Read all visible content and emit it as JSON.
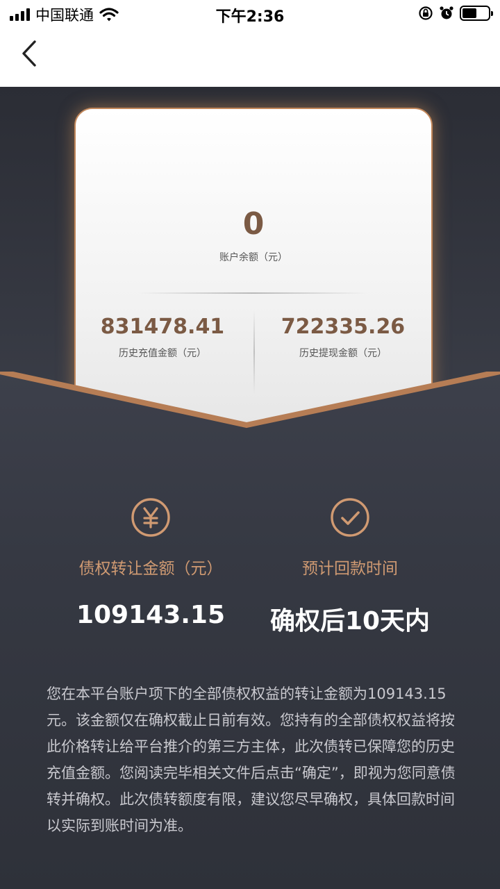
{
  "status_bar": {
    "carrier": "中国联通",
    "time": "下午2:36"
  },
  "card": {
    "balance_value": "0",
    "balance_label": "账户余额（元）",
    "recharge_value": "831478.41",
    "recharge_label": "历史充值金额（元）",
    "withdraw_value": "722335.26",
    "withdraw_label": "历史提现金额（元）"
  },
  "features": {
    "transfer_label": "债权转让金额（元）",
    "transfer_value": "109143.15",
    "repay_label": "预计回款时间",
    "repay_value": "确权后10天内"
  },
  "description": "您在本平台账户项下的全部债权权益的转让金额为109143.15元。该金额仅在确权截止日前有效。您持有的全部债权权益将按此价格转让给平台推介的第三方主体，此次债转已保障您的历史充值金额。您阅读完毕相关文件后点击“确定”，即视为您同意债转并确权。此次债转额度有限，建议您尽早确权，具体回款时间以实际到账时间为准。",
  "colors": {
    "accent": "#d09a72",
    "card_value": "#7b5a44",
    "background": "#2f323b"
  },
  "icons": {
    "transfer": "yuan-circle-icon",
    "repay": "check-circle-icon"
  }
}
